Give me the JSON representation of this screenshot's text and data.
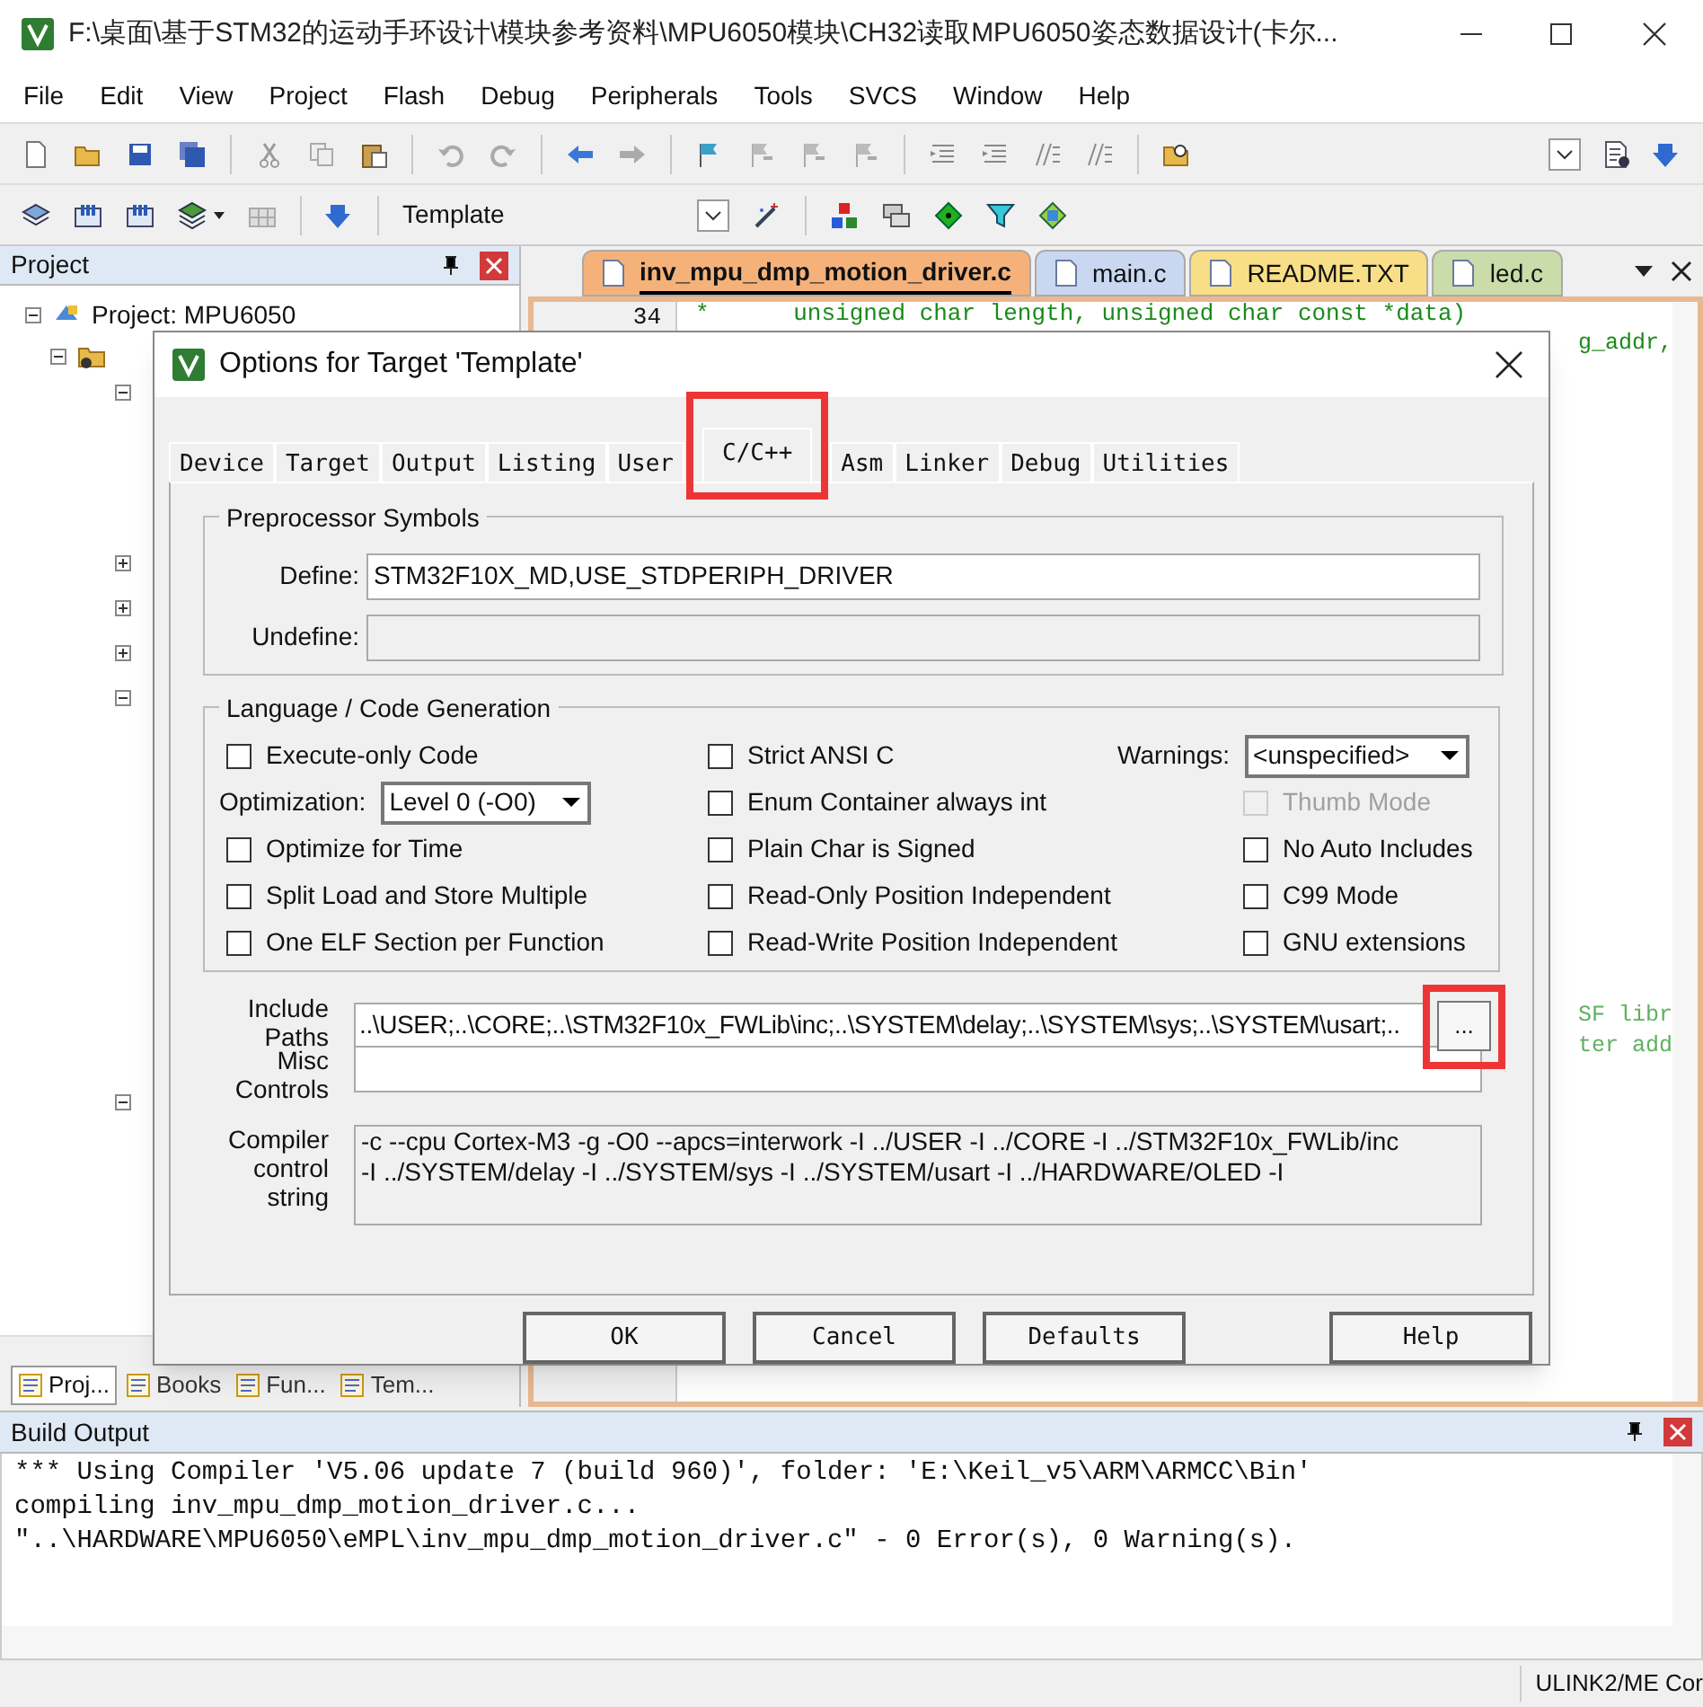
{
  "window": {
    "title": "F:\\桌面\\基于STM32的运动手环设计\\模块参考资料\\MPU6050模块\\CH32读取MPU6050姿态数据设计(卡尔..."
  },
  "menu": [
    "File",
    "Edit",
    "View",
    "Project",
    "Flash",
    "Debug",
    "Peripherals",
    "Tools",
    "SVCS",
    "Window",
    "Help"
  ],
  "toolbar": {
    "target": "Template"
  },
  "project_panel": {
    "title": "Project",
    "tree": [
      {
        "label": "Project: MPU6050",
        "expanded": true
      }
    ]
  },
  "panel_tabs": [
    {
      "label": "Proj...",
      "selected": true
    },
    {
      "label": "Books",
      "selected": false
    },
    {
      "label": "Fun...",
      "selected": false
    },
    {
      "label": "Tem...",
      "selected": false
    }
  ],
  "editor": {
    "tabs": [
      {
        "label": "inv_mpu_dmp_motion_driver.c",
        "selected": true,
        "color": "#f4b27a"
      },
      {
        "label": "main.c",
        "selected": false,
        "color": "#c9d8f0"
      },
      {
        "label": "README.TXT",
        "selected": false,
        "color": "#f8de86"
      },
      {
        "label": "led.c",
        "selected": false,
        "color": "#c9dcaa"
      }
    ],
    "line_number": "34",
    "code": "*      unsigned char length, unsigned char const *data)",
    "right_fragments": [
      "g_addr,",
      "SF libr",
      "ter add"
    ]
  },
  "dialog": {
    "title": "Options for Target 'Template'",
    "tabs": [
      {
        "label": "Device",
        "selected": false,
        "highlighted": false
      },
      {
        "label": "Target",
        "selected": false,
        "highlighted": false
      },
      {
        "label": "Output",
        "selected": false,
        "highlighted": false
      },
      {
        "label": "Listing",
        "selected": false,
        "highlighted": false
      },
      {
        "label": "User",
        "selected": false,
        "highlighted": false
      },
      {
        "label": "C/C++",
        "selected": true,
        "highlighted": true
      },
      {
        "label": "Asm",
        "selected": false,
        "highlighted": false
      },
      {
        "label": "Linker",
        "selected": false,
        "highlighted": false
      },
      {
        "label": "Debug",
        "selected": false,
        "highlighted": false
      },
      {
        "label": "Utilities",
        "selected": false,
        "highlighted": false
      }
    ],
    "preprocessor": {
      "title": "Preprocessor Symbols",
      "define_label": "Define:",
      "define": "STM32F10X_MD,USE_STDPERIPH_DRIVER",
      "undefine_label": "Undefine:"
    },
    "language": {
      "title": "Language / Code Generation",
      "columns": [
        [
          {
            "kind": "checkbox",
            "label": "Execute-only Code",
            "checked": false,
            "disabled": false
          },
          {
            "kind": "select",
            "label": "Optimization:",
            "value": "Level 0 (-O0)"
          },
          {
            "kind": "checkbox",
            "label": "Optimize for Time",
            "checked": false,
            "disabled": false
          },
          {
            "kind": "checkbox",
            "label": "Split Load and Store Multiple",
            "checked": false,
            "disabled": false
          },
          {
            "kind": "checkbox",
            "label": "One ELF Section per Function",
            "checked": false,
            "disabled": false
          }
        ],
        [
          {
            "kind": "checkbox",
            "label": "Strict ANSI C",
            "checked": false,
            "disabled": false
          },
          {
            "kind": "checkbox",
            "label": "Enum Container always int",
            "checked": false,
            "disabled": false
          },
          {
            "kind": "checkbox",
            "label": "Plain Char is Signed",
            "checked": false,
            "disabled": false
          },
          {
            "kind": "checkbox",
            "label": "Read-Only Position Independent",
            "checked": false,
            "disabled": false
          },
          {
            "kind": "checkbox",
            "label": "Read-Write Position Independent",
            "checked": false,
            "disabled": false
          }
        ],
        [
          {
            "kind": "select",
            "label": "Warnings:",
            "value": "<unspecified>"
          },
          {
            "kind": "checkbox",
            "label": "Thumb Mode",
            "checked": false,
            "disabled": true
          },
          {
            "kind": "checkbox",
            "label": "No Auto Includes",
            "checked": false,
            "disabled": false
          },
          {
            "kind": "checkbox",
            "label": "C99 Mode",
            "checked": false,
            "disabled": false
          },
          {
            "kind": "checkbox",
            "label": "GNU extensions",
            "checked": false,
            "disabled": false
          }
        ]
      ]
    },
    "include_paths_label": "Include Paths",
    "include_paths": "..\\USER;..\\CORE;..\\STM32F10x_FWLib\\inc;..\\SYSTEM\\delay;..\\SYSTEM\\sys;..\\SYSTEM\\usart;..",
    "browse_button": {
      "label": "...",
      "highlighted": true
    },
    "misc_controls_label": "Misc Controls",
    "compiler_string_label": "Compiler control string",
    "compiler_string": "-c --cpu Cortex-M3 -g -O0 --apcs=interwork -I ../USER -I ../CORE -I ../STM32F10x_FWLib/inc -I ../SYSTEM/delay -I ../SYSTEM/sys -I ../SYSTEM/usart -I ../HARDWARE/OLED -I",
    "buttons": [
      "OK",
      "Cancel",
      "Defaults",
      "Help"
    ]
  },
  "build_output": {
    "title": "Build Output",
    "lines": [
      "*** Using Compiler 'V5.06 update 7 (build 960)', folder: 'E:\\Keil_v5\\ARM\\ARMCC\\Bin'",
      "compiling inv_mpu_dmp_motion_driver.c...",
      "\"..\\HARDWARE\\MPU6050\\eMPL\\inv_mpu_dmp_motion_driver.c\" - 0 Error(s), 0 Warning(s)."
    ]
  },
  "status_bar": {
    "debugger": "ULINK2/ME Cor"
  }
}
